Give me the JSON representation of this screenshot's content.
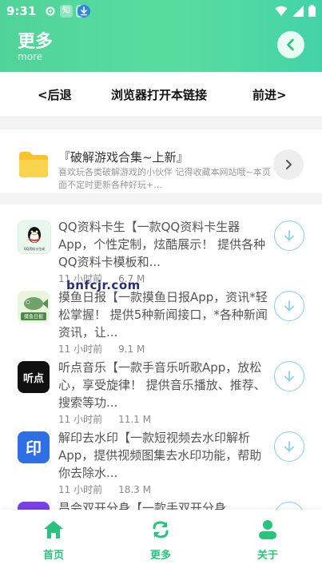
{
  "status_bar": {
    "time": "9:31",
    "icons": [
      "settings-icon",
      "app-icon",
      "app-icon",
      "download-icon"
    ],
    "right_icons": [
      "wifi-icon",
      "signal-icon",
      "battery-icon"
    ]
  },
  "header": {
    "title": "更多",
    "subtitle": "more"
  },
  "nav": {
    "back_label": "<后退",
    "open_label": "浏览器打开本链接",
    "forward_label": "前进>"
  },
  "promo": {
    "title": "『破解游戏合集~上新』",
    "description": "喜欢玩各类破解游戏的小伙伴 记得收藏本网站哦~本页面不定时更新各种好玩+..."
  },
  "apps": [
    {
      "icon": "qq-penguin-icon",
      "icon_text": "QQ资料卡生成",
      "description": "QQ资料卡生【一款QQ资料卡生器App，个性定制，炫酷展示！ 提供各种QQ资料卡模板和...",
      "time": "11 小时前",
      "size": "6.7 M"
    },
    {
      "icon": "fish-icon",
      "icon_text": "摸鱼日报",
      "description": "摸鱼日报【一款摸鱼日报App，资讯*轻松掌握！ 提供5种新闻接口，*各种新闻资讯，让...",
      "time": "11 小时前",
      "size": "9.1 M"
    },
    {
      "icon": "music-icon",
      "icon_text": "听点",
      "description": "听点音乐【一款手音乐听歌App，放松心，享受旋律！ 提供音乐播放、推荐、搜索等功...",
      "time": "11 小时前",
      "size": "11.1 M"
    },
    {
      "icon": "watermark-remove-icon",
      "icon_text": "印",
      "description": "解印去水印【一款短视频去水印解析App，提供视频图集去水印功能，帮助你去除水...",
      "time": "11 小时前",
      "size": "18.3 M"
    },
    {
      "icon": "dual-app-icon",
      "icon_text": "",
      "description": "昌会双开分身【一款手双开分身",
      "time": "",
      "size": ""
    }
  ],
  "watermark": "bnfcjr.com",
  "tabs": [
    {
      "label": "首页",
      "icon": "home-icon"
    },
    {
      "label": "更多",
      "icon": "refresh-icon"
    },
    {
      "label": "关于",
      "icon": "user-icon"
    }
  ],
  "colors": {
    "accent": "#27c47c",
    "header_start": "#4fd39a",
    "header_end": "#43d3a8",
    "download_border": "#8ad0ee"
  }
}
